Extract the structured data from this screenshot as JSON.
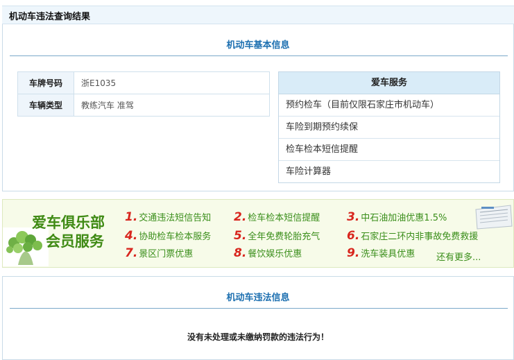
{
  "page": {
    "title": "机动车违法查询结果"
  },
  "basic_info": {
    "heading": "机动车基本信息",
    "rows": [
      {
        "label": "车牌号码",
        "value": "浙E1035"
      },
      {
        "label": "车辆类型",
        "value": "教练汽车 准驾"
      }
    ]
  },
  "service": {
    "heading": "爱车服务",
    "items": [
      "预约检车（目前仅限石家庄市机动车）",
      "车险到期预约续保",
      "检车检本短信提醒",
      "车险计算器"
    ]
  },
  "banner": {
    "title_line1": "爱车俱乐部",
    "title_line2": "会员服务",
    "benefits": [
      {
        "num": "1.",
        "text": "交通违法短信告知"
      },
      {
        "num": "2.",
        "text": "检车检本短信提醒"
      },
      {
        "num": "3.",
        "text": "中石油加油优惠1.5%"
      },
      {
        "num": "4.",
        "text": "协助检车检本服务"
      },
      {
        "num": "5.",
        "text": "全年免费轮胎充气"
      },
      {
        "num": "6.",
        "text": "石家庄二环内非事故免费救援"
      },
      {
        "num": "7.",
        "text": "景区门票优惠"
      },
      {
        "num": "8.",
        "text": "餐饮娱乐优惠"
      },
      {
        "num": "9.",
        "text": "洗车装具优惠"
      }
    ],
    "more": "还有更多..."
  },
  "violation": {
    "heading": "机动车违法信息",
    "message": "没有未处理或未缴纳罚款的违法行为！"
  },
  "colors": {
    "heading_blue": "#1c6fb0",
    "banner_green": "#3a8e1a",
    "banner_red": "#d8261e"
  }
}
